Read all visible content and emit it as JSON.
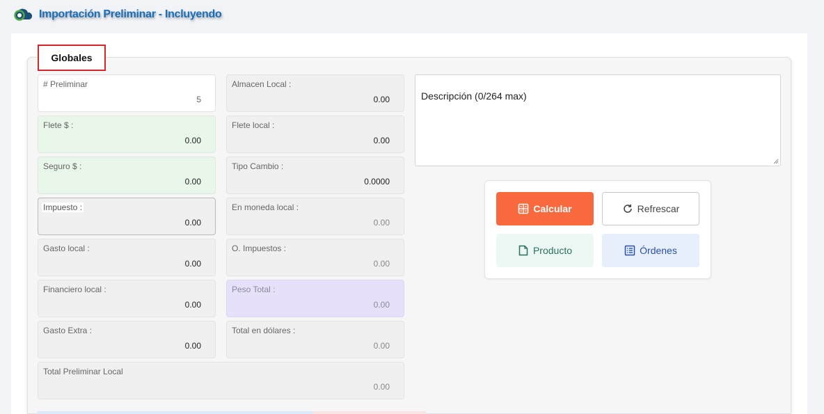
{
  "header": {
    "title": "Importación Preliminar - Incluyendo",
    "logo_icon": "cloud-logo-icon"
  },
  "tabs": [
    {
      "label": "Globales",
      "active": true
    }
  ],
  "left_fields": [
    {
      "label": "# Preliminar",
      "value": "5"
    },
    {
      "label": "Flete $ :",
      "value": "0.00"
    },
    {
      "label": "Seguro $ :",
      "value": "0.00"
    },
    {
      "label": "Impuesto :",
      "value": "0.00"
    },
    {
      "label": "Gasto local :",
      "value": "0.00"
    },
    {
      "label": "Financiero local :",
      "value": "0.00"
    },
    {
      "label": "Gasto Extra :",
      "value": "0.00"
    }
  ],
  "right_fields": [
    {
      "label": "Almacen Local :",
      "value": "0.00"
    },
    {
      "label": "Flete local :",
      "value": "0.00"
    },
    {
      "label": "Tipo Cambio :",
      "value": "0.0000"
    },
    {
      "label": "En moneda local :",
      "value": "0.00"
    },
    {
      "label": "O. Impuestos :",
      "value": "0.00"
    },
    {
      "label": "Peso Total :",
      "value": "0.00"
    },
    {
      "label": "Total en dólares :",
      "value": "0.00"
    }
  ],
  "total_field": {
    "label": "Total Preliminar Local",
    "value": "0.00"
  },
  "description": {
    "placeholder": "Descripción (0/264 max)"
  },
  "buttons": {
    "calcular": "Calcular",
    "refrescar": "Refrescar",
    "producto": "Producto",
    "ordenes": "Órdenes"
  },
  "colors": {
    "accent_orange": "#f8693d",
    "title_blue": "#1a6fb8",
    "tab_border_red": "#d9252a",
    "green_field": "#e9f6ea",
    "purple_field": "#e6e0fa"
  }
}
